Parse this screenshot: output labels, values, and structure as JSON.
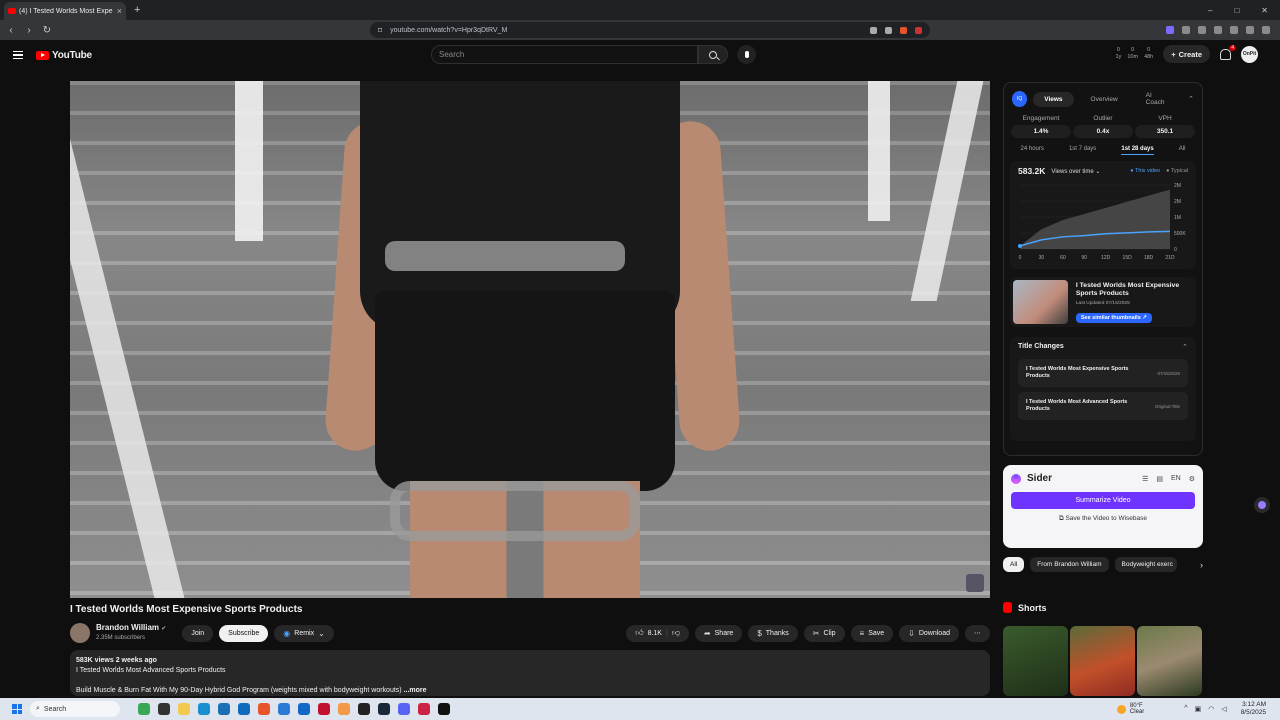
{
  "browser": {
    "tab_title": "(4) I Tested Worlds Most Expe",
    "url": "youtube.com/watch?v=Hpr3qDtRV_M",
    "new_tab": "+",
    "window_controls": [
      "–",
      "□",
      "✕"
    ]
  },
  "header": {
    "logo_text": "YouTube",
    "search_placeholder": "Search",
    "create_label": "Create",
    "notifications_count": "4",
    "avatar_text": "OnPit",
    "mini_stats": [
      {
        "top": "0",
        "bottom": "1y"
      },
      {
        "top": "0",
        "bottom": "10m"
      },
      {
        "top": "0",
        "bottom": "48h"
      }
    ]
  },
  "video": {
    "title": "I Tested Worlds Most Expensive Sports Products",
    "channel_name": "Brandon William",
    "subscribers": "2.35M subscribers",
    "join_label": "Join",
    "subscribe_label": "Subscribe",
    "remix_label": "Remix",
    "likes": "8.1K",
    "share_label": "Share",
    "thanks_label": "Thanks",
    "clip_label": "Clip",
    "save_label": "Save",
    "download_label": "Download",
    "more_dots": "⋯",
    "description_meta": "583K views  2 weeks ago",
    "description_line1": "I Tested Worlds Most Advanced Sports Products",
    "description_line2": "Build Muscle & Burn Fat With My 90-Day Hybrid God Program (weights mixed with bodyweight workouts)",
    "description_more": "...more"
  },
  "analytics": {
    "logo": "IQ",
    "tabs": [
      "Views",
      "Overview",
      "AI Coach"
    ],
    "metrics": [
      {
        "label": "Engagement",
        "value": "1.4%"
      },
      {
        "label": "Outlier",
        "value": "0.4x"
      },
      {
        "label": "VPH",
        "value": "350.1"
      }
    ],
    "ranges": [
      "24 hours",
      "1st 7 days",
      "1st 28 days",
      "All"
    ],
    "total_views": "583.2K",
    "views_selector": "Views over time",
    "legend_this": "This video",
    "legend_typical": "Typical",
    "thumbnail_title": "I Tested Worlds Most Expensive Sports Products",
    "last_updated": "Last Updated 07/15/2025",
    "similar_button": "See similar thumbnails ↗",
    "title_changes_label": "Title Changes",
    "title_changes": [
      {
        "title": "I Tested Worlds Most Expensive Sports Products",
        "date": "07/15/2025"
      },
      {
        "title": "I Tested Worlds Most Advanced Sports Products",
        "date": "Original Title"
      }
    ]
  },
  "chart_data": {
    "type": "area",
    "x": [
      0,
      3,
      6,
      9,
      12,
      15,
      18,
      21
    ],
    "x_tick_labels": [
      "0",
      "30",
      "60",
      "90",
      "12D",
      "15D",
      "18D",
      "21D"
    ],
    "y_tick_labels": [
      "2M",
      "2M",
      "1M",
      "500K",
      "0"
    ],
    "series": [
      {
        "name": "This video",
        "values": [
          0.1,
          0.3,
          0.4,
          0.44,
          0.5,
          0.53,
          0.56,
          0.58
        ]
      },
      {
        "name": "Typical",
        "values": [
          0.1,
          0.65,
          0.95,
          1.15,
          1.35,
          1.55,
          1.75,
          1.95
        ]
      }
    ],
    "ylim": [
      0,
      2.1
    ],
    "colors": {
      "this": "#4aa3ff",
      "typical": "#4a4a4a"
    }
  },
  "sider": {
    "name": "Sider",
    "lang": "EN",
    "summarize_label": "Summarize Video",
    "save_label": "Save the Video to Wisebase"
  },
  "chips": [
    "All",
    "From Brandon William",
    "Bodyweight exerc"
  ],
  "shorts_label": "Shorts",
  "taskbar": {
    "search_placeholder": "Search",
    "weather_temp": "80°F",
    "weather_desc": "Clear",
    "time": "3:12 AM",
    "date": "8/5/2025"
  }
}
